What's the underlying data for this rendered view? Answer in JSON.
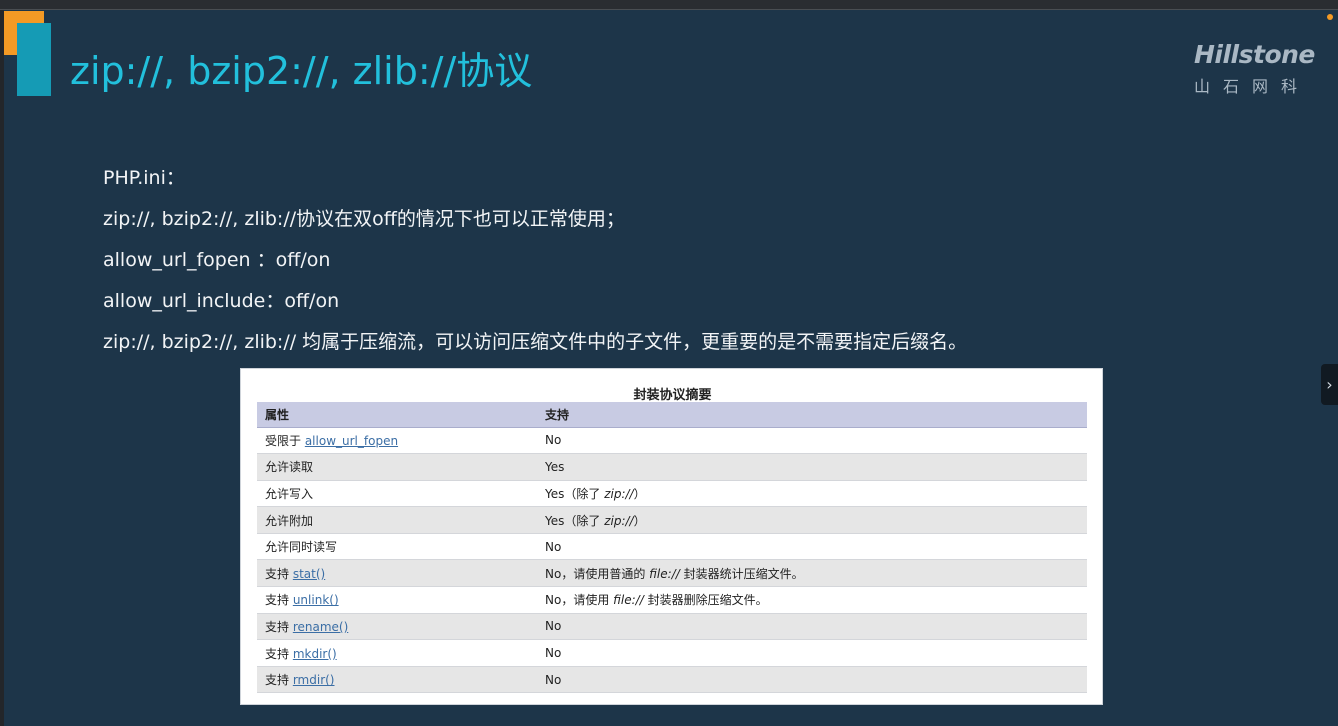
{
  "slide": {
    "title": "zip://, bzip2://, zlib://协议",
    "logo": {
      "brand": "Hillstone",
      "brand_cn": "山石网科"
    },
    "lines": [
      "PHP.ini：",
      "zip://, bzip2://, zlib://协议在双off的情况下也可以正常使用；",
      "allow_url_fopen ：off/on",
      "allow_url_include：off/on",
      "zip://, bzip2://, zlib:// 均属于压缩流，可以访问压缩文件中的子文件，更重要的是不需要指定后缀名。"
    ],
    "next_icon": "chevron-right-icon"
  },
  "table": {
    "caption": "封装协议摘要",
    "headers": [
      "属性",
      "支持"
    ],
    "rows": [
      {
        "prefix": "受限于 ",
        "fn": "allow_url_fopen",
        "value": "No"
      },
      {
        "prefix": "允许读取",
        "fn": "",
        "value": "Yes"
      },
      {
        "prefix": "允许写入",
        "fn": "",
        "value": "Yes（除了 ",
        "value_it": "zip://",
        "value_tail": "）"
      },
      {
        "prefix": "允许附加",
        "fn": "",
        "value": "Yes（除了 ",
        "value_it": "zip://",
        "value_tail": "）"
      },
      {
        "prefix": "允许同时读写",
        "fn": "",
        "value": "No"
      },
      {
        "prefix": "支持 ",
        "fn": "stat()",
        "value": "No，请使用普通的 ",
        "value_it": "file://",
        "value_tail": " 封装器统计压缩文件。"
      },
      {
        "prefix": "支持 ",
        "fn": "unlink()",
        "value": "No，请使用 ",
        "value_it": "file://",
        "value_tail": " 封装器删除压缩文件。"
      },
      {
        "prefix": "支持 ",
        "fn": "rename()",
        "value": "No"
      },
      {
        "prefix": "支持 ",
        "fn": "mkdir()",
        "value": "No"
      },
      {
        "prefix": "支持 ",
        "fn": "rmdir()",
        "value": "No"
      }
    ]
  },
  "colors": {
    "background": "#1d3549",
    "title": "#22c0dc",
    "accent_bar": "#159bb5",
    "orange": "#f39a25",
    "table_header": "#c8cbe3",
    "link": "#3b6ea5"
  }
}
